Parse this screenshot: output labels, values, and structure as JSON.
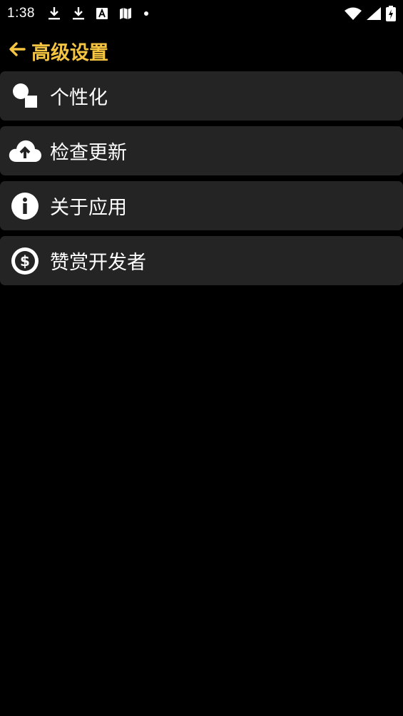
{
  "status_bar": {
    "time": "1:38",
    "left_icons": [
      "download-icon",
      "download-icon",
      "font-a-icon",
      "map-icon",
      "dot-icon"
    ],
    "right_icons": [
      "wifi-icon",
      "cell-signal-icon",
      "battery-charging-icon"
    ]
  },
  "header": {
    "title": "高级设置",
    "back_icon": "arrow-left-icon"
  },
  "colors": {
    "accent": "#f5c542",
    "background": "#000000",
    "item_background": "#242424",
    "text": "#ffffff"
  },
  "menu": {
    "items": [
      {
        "label": "个性化",
        "icon": "shapes-icon"
      },
      {
        "label": "检查更新",
        "icon": "cloud-upload-icon"
      },
      {
        "label": "关于应用",
        "icon": "info-icon"
      },
      {
        "label": "赞赏开发者",
        "icon": "dollar-coin-icon"
      }
    ]
  }
}
